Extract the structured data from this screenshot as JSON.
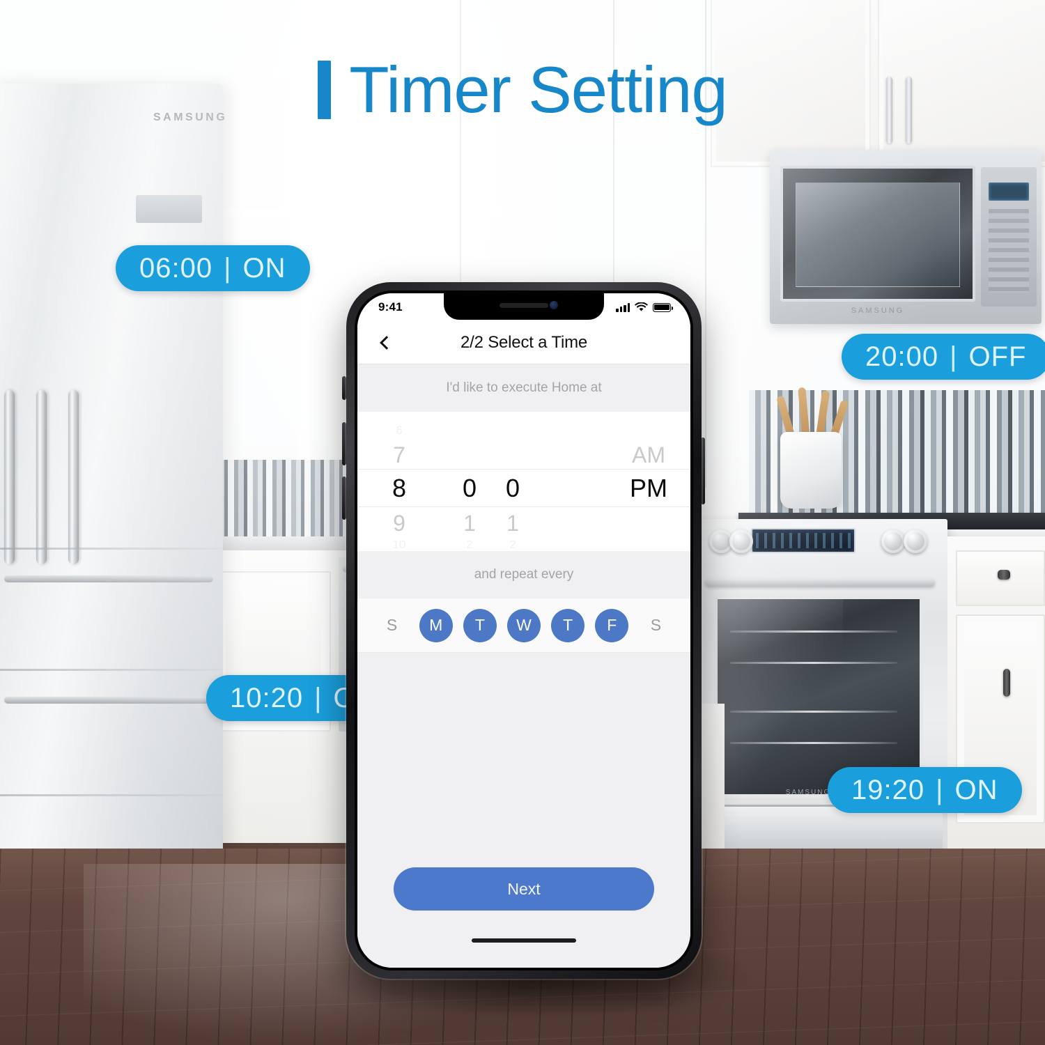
{
  "page": {
    "title_accent": "▌",
    "title": "Timer Setting",
    "title_color": "#1787c9"
  },
  "pills": [
    {
      "name": "pill-0600-on",
      "time": "06:00",
      "sep": "|",
      "state": "ON"
    },
    {
      "name": "pill-2000-off",
      "time": "20:00",
      "sep": "|",
      "state": "OFF"
    },
    {
      "name": "pill-1020-on",
      "time": "10:20",
      "sep": "|",
      "state": "ON"
    },
    {
      "name": "pill-1920-on",
      "time": "19:20",
      "sep": "|",
      "state": "ON"
    }
  ],
  "pill_color": "#1a9fdc",
  "phone": {
    "statusbar": {
      "time": "9:41",
      "signal_icon": "cellular-signal-icon",
      "wifi_icon": "wifi-icon",
      "battery_icon": "battery-icon"
    },
    "navbar": {
      "back_icon": "chevron-left-icon",
      "title": "2/2 Select a Time"
    },
    "time_section": {
      "header": "I'd like to execute Home at",
      "hour_column": [
        "6",
        "7",
        "8",
        "9",
        "10"
      ],
      "minute_tens": [
        "",
        "",
        "0",
        "1",
        "2"
      ],
      "minute_ones": [
        "",
        "",
        "0",
        "1",
        "2"
      ],
      "ampm_column": [
        "",
        "AM",
        "PM",
        "",
        ""
      ],
      "selected_hour": "8",
      "selected_minute": "00",
      "selected_ampm": "PM"
    },
    "repeat_section": {
      "header": "and repeat every",
      "days": [
        {
          "label": "S",
          "name": "day-sunday",
          "selected": false
        },
        {
          "label": "M",
          "name": "day-monday",
          "selected": true
        },
        {
          "label": "T",
          "name": "day-tuesday",
          "selected": true
        },
        {
          "label": "W",
          "name": "day-wednesday",
          "selected": true
        },
        {
          "label": "T",
          "name": "day-thursday",
          "selected": true
        },
        {
          "label": "F",
          "name": "day-friday",
          "selected": true
        },
        {
          "label": "S",
          "name": "day-saturday",
          "selected": false
        }
      ],
      "selected_day_color": "#4d78c6"
    },
    "next_button": {
      "label": "Next",
      "color": "#4d79cc"
    },
    "home_indicator": "home-indicator"
  },
  "background": {
    "fridge_brand": "SAMSUNG",
    "microwave_brand": "SAMSUNG",
    "range_brand": "SAMSUNG"
  }
}
